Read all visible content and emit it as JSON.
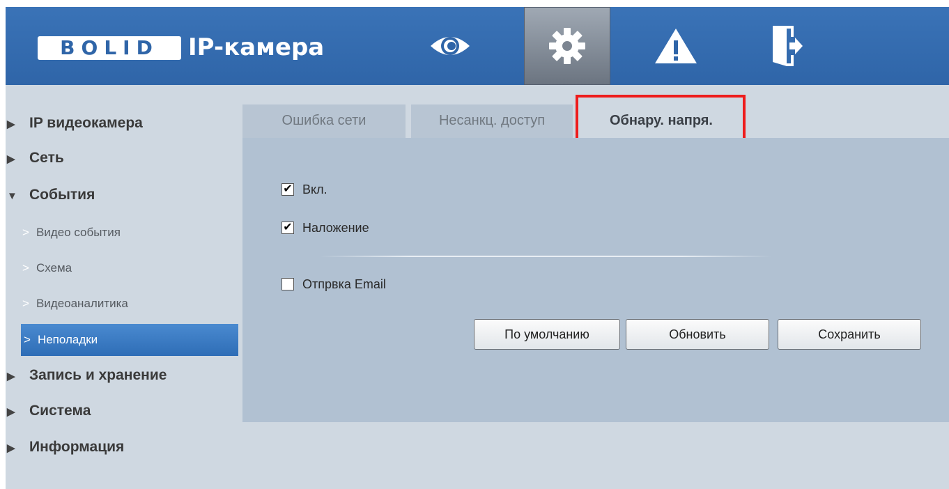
{
  "header": {
    "logo_text": "BOLID",
    "app_title": "IP-камера",
    "nav": [
      {
        "icon": "eye-icon",
        "active": false
      },
      {
        "icon": "gear-icon",
        "active": true
      },
      {
        "icon": "warning-icon",
        "active": false
      },
      {
        "icon": "logout-icon",
        "active": false
      }
    ]
  },
  "sidebar": {
    "items": [
      {
        "label": "IP видеокамера",
        "level": 1,
        "expanded": false
      },
      {
        "label": "Сеть",
        "level": 1,
        "expanded": false
      },
      {
        "label": "События",
        "level": 1,
        "expanded": true
      },
      {
        "label": "Видео события",
        "level": 2
      },
      {
        "label": "Схема",
        "level": 2
      },
      {
        "label": "Видеоаналитика",
        "level": 2
      },
      {
        "label": "Неполадки",
        "level": 2,
        "active": true
      },
      {
        "label": "Запись и хранение",
        "level": 1,
        "expanded": false
      },
      {
        "label": "Система",
        "level": 1,
        "expanded": false
      },
      {
        "label": "Информация",
        "level": 1,
        "expanded": false
      }
    ]
  },
  "tabs": [
    {
      "label": "Ошибка сети",
      "active": false
    },
    {
      "label": "Несанкц. доступ",
      "active": false
    },
    {
      "label": "Обнару. напря.",
      "active": true
    }
  ],
  "form": {
    "enable": {
      "label": "Вкл.",
      "checked": true
    },
    "overlay": {
      "label": "Наложение",
      "checked": true
    },
    "send_email": {
      "label": "Отпрвка Email",
      "checked": false
    }
  },
  "buttons": {
    "default_label": "По умолчанию",
    "refresh_label": "Обновить",
    "save_label": "Сохранить"
  },
  "colors": {
    "header": "#2f65a8",
    "highlight": "#ee1c1c",
    "active_item": "#3a7cc4"
  }
}
